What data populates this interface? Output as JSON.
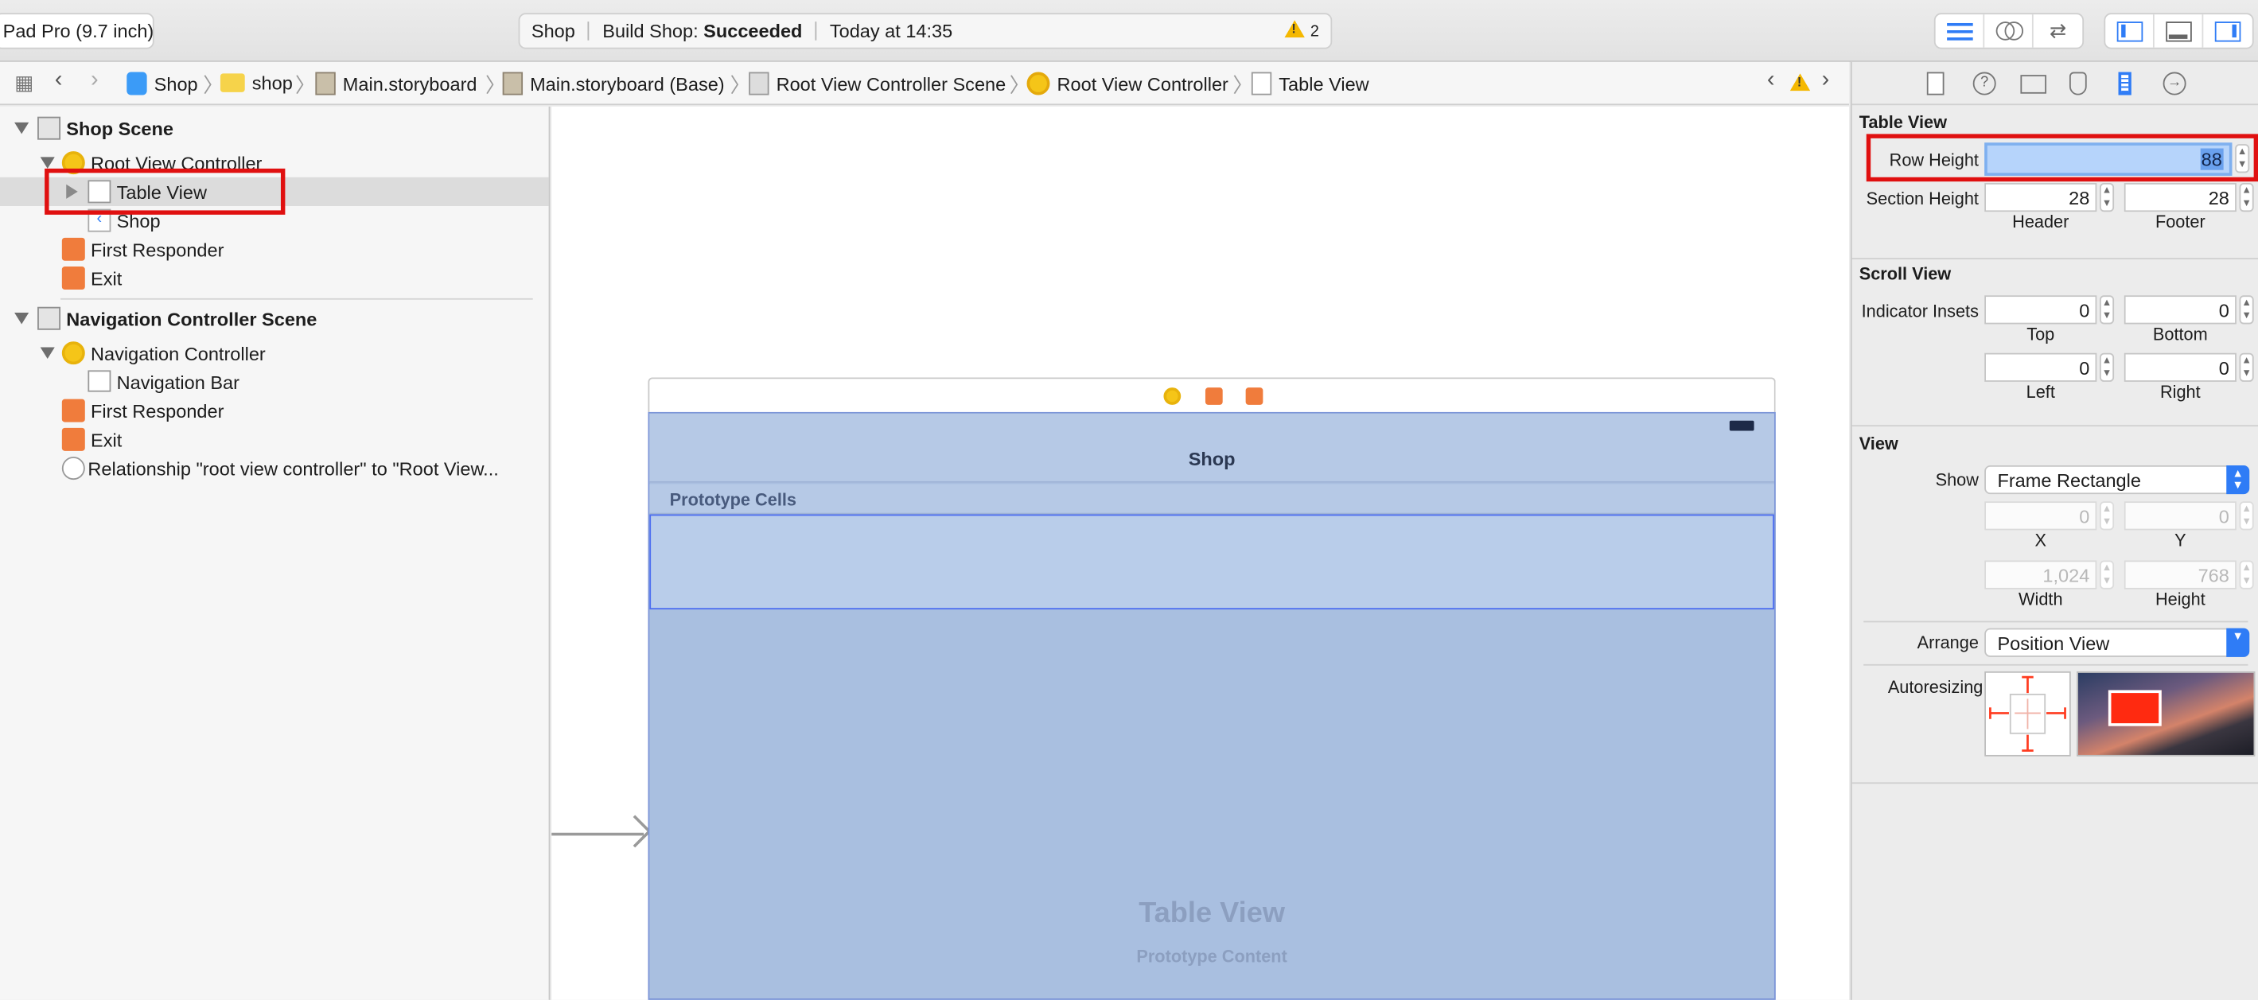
{
  "toolbar": {
    "scheme_device": "Pad Pro (9.7 inch)",
    "activity": {
      "project": "Shop",
      "status_prefix": "Build Shop:",
      "status_value": "Succeeded",
      "time": "Today at 14:35",
      "warning_count": "2"
    }
  },
  "jumpbar": {
    "items": [
      "Shop",
      "shop",
      "Main.storyboard",
      "Main.storyboard (Base)",
      "Root View Controller Scene",
      "Root View Controller",
      "Table View"
    ]
  },
  "outline": {
    "shop_scene": "Shop Scene",
    "root_vc": "Root View Controller",
    "table_view": "Table View",
    "shop_item": "Shop",
    "first_responder_1": "First Responder",
    "exit_1": "Exit",
    "nav_scene": "Navigation Controller Scene",
    "nav_controller": "Navigation Controller",
    "nav_bar": "Navigation Bar",
    "first_responder_2": "First Responder",
    "exit_2": "Exit",
    "relationship": "Relationship \"root view controller\" to \"Root View..."
  },
  "canvas": {
    "nav_title": "Shop",
    "prototype_cells": "Prototype Cells",
    "table_view_label": "Table View",
    "prototype_content": "Prototype Content"
  },
  "inspector": {
    "table_view_section": "Table View",
    "row_height_label": "Row Height",
    "row_height_value": "88",
    "section_height_label": "Section Height",
    "header_value": "28",
    "footer_value": "28",
    "header_label": "Header",
    "footer_label": "Footer",
    "scroll_view_section": "Scroll View",
    "indicator_insets_label": "Indicator Insets",
    "top_value": "0",
    "bottom_value": "0",
    "top_label": "Top",
    "bottom_label": "Bottom",
    "left_value": "0",
    "right_value": "0",
    "left_label": "Left",
    "right_label": "Right",
    "view_section": "View",
    "show_label": "Show",
    "show_value": "Frame Rectangle",
    "x_value": "0",
    "y_value": "0",
    "x_label": "X",
    "y_label": "Y",
    "width_value": "1,024",
    "height_value": "768",
    "width_label": "Width",
    "height_label": "Height",
    "arrange_label": "Arrange",
    "arrange_value": "Position View",
    "autoresizing_label": "Autoresizing"
  },
  "colors": {
    "accent": "#2f7cf6",
    "highlight_box": "#e01010",
    "warning": "#f5b800"
  }
}
